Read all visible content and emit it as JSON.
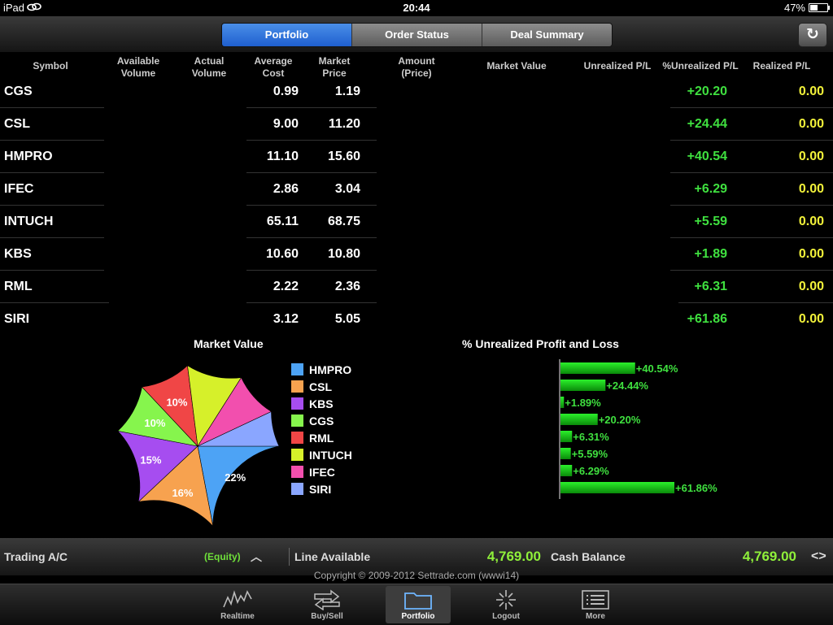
{
  "status": {
    "device": "iPad",
    "time": "20:44",
    "battery": "47%"
  },
  "tabs": [
    "Portfolio",
    "Order Status",
    "Deal Summary"
  ],
  "active_tab": 0,
  "columns": {
    "symbol": "Symbol",
    "available_volume": "Available Volume",
    "actual_volume": "Actual Volume",
    "average_cost": "Average Cost",
    "market_price": "Market Price",
    "amount": "Amount (Price)",
    "market_value": "Market Value",
    "unrealized": "Unrealized P/L",
    "pct_unrealized": "%Unrealized P/L",
    "realized": "Realized P/L"
  },
  "rows": [
    {
      "symbol": "CGS",
      "avg_cost": "0.99",
      "market_price": "1.19",
      "pct_unrealized": "+20.20",
      "realized": "0.00"
    },
    {
      "symbol": "CSL",
      "avg_cost": "9.00",
      "market_price": "11.20",
      "pct_unrealized": "+24.44",
      "realized": "0.00"
    },
    {
      "symbol": "HMPRO",
      "avg_cost": "11.10",
      "market_price": "15.60",
      "pct_unrealized": "+40.54",
      "realized": "0.00"
    },
    {
      "symbol": "IFEC",
      "avg_cost": "2.86",
      "market_price": "3.04",
      "pct_unrealized": "+6.29",
      "realized": "0.00"
    },
    {
      "symbol": "INTUCH",
      "avg_cost": "65.11",
      "market_price": "68.75",
      "pct_unrealized": "+5.59",
      "realized": "0.00"
    },
    {
      "symbol": "KBS",
      "avg_cost": "10.60",
      "market_price": "10.80",
      "pct_unrealized": "+1.89",
      "realized": "0.00"
    },
    {
      "symbol": "RML",
      "avg_cost": "2.22",
      "market_price": "2.36",
      "pct_unrealized": "+6.31",
      "realized": "0.00"
    },
    {
      "symbol": "SIRI",
      "avg_cost": "3.12",
      "market_price": "5.05",
      "pct_unrealized": "+61.86",
      "realized": "0.00"
    }
  ],
  "chart_data": [
    {
      "type": "pie",
      "title": "Market Value",
      "categories": [
        "HMPRO",
        "CSL",
        "KBS",
        "CGS",
        "RML",
        "INTUCH",
        "IFEC",
        "SIRI"
      ],
      "values": [
        22,
        16,
        15,
        10,
        10,
        11,
        9,
        7
      ],
      "slice_labels": [
        "22%",
        "16%",
        "15%",
        "10%",
        "10%",
        "",
        "",
        ""
      ],
      "colors": [
        "#4da3f5",
        "#f7a24f",
        "#a64df0",
        "#86f54d",
        "#f04646",
        "#d6f02a",
        "#f24fae",
        "#8aa6ff"
      ]
    },
    {
      "type": "bar",
      "title": "% Unrealized Profit and Loss",
      "categories": [
        "HMPRO",
        "CSL",
        "KBS",
        "CGS",
        "RML",
        "INTUCH",
        "IFEC",
        "SIRI"
      ],
      "values": [
        40.54,
        24.44,
        1.89,
        20.2,
        6.31,
        5.59,
        6.29,
        61.86
      ],
      "labels": [
        "+40.54%",
        "+24.44%",
        "+1.89%",
        "+20.20%",
        "+6.31%",
        "+5.59%",
        "+6.29%",
        "+61.86%"
      ],
      "color": "#1fd11f"
    }
  ],
  "info": {
    "trading_label": "Trading A/C",
    "account_type": "(Equity)",
    "line_label": "Line Available",
    "line_value": "4,769.00",
    "cash_label": "Cash Balance",
    "cash_value": "4,769.00"
  },
  "copyright": "Copyright © 2009-2012 Settrade.com (wwwi14)",
  "tabbar": [
    "Realtime",
    "Buy/Sell",
    "Portfolio",
    "Logout",
    "More"
  ],
  "tabbar_active": 2,
  "icons": {
    "refresh": "refresh-icon",
    "expand": "chevron-up-icon",
    "swap": "left-right-arrows-icon"
  }
}
